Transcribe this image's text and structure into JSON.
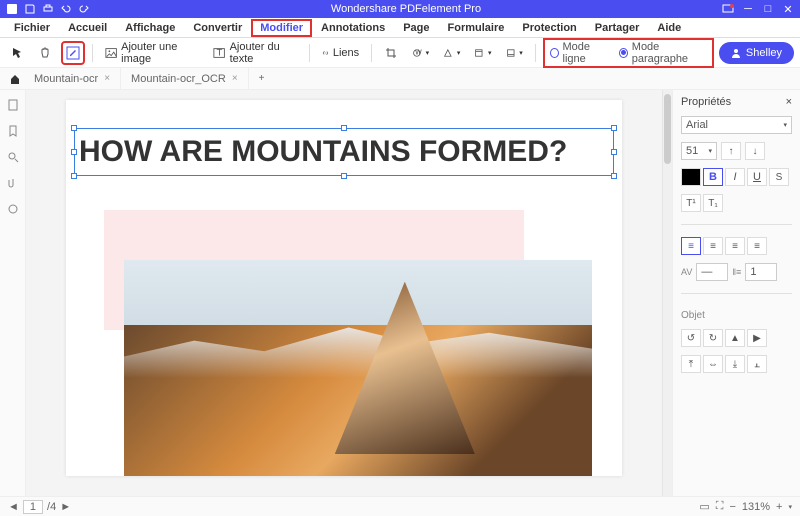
{
  "app": {
    "title": "Wondershare PDFelement Pro"
  },
  "menus": [
    "Fichier",
    "Accueil",
    "Affichage",
    "Convertir",
    "Modifier",
    "Annotations",
    "Page",
    "Formulaire",
    "Protection",
    "Partager",
    "Aide"
  ],
  "active_menu": "Modifier",
  "toolbar": {
    "add_image": "Ajouter une image",
    "add_text": "Ajouter du texte",
    "links": "Liens",
    "mode_line": "Mode ligne",
    "mode_paragraph": "Mode paragraphe",
    "mode_selected": "paragraph"
  },
  "user": {
    "name": "Shelley"
  },
  "tabs": [
    {
      "label": "Mountain-ocr"
    },
    {
      "label": "Mountain-ocr_OCR"
    }
  ],
  "document": {
    "headline": "HOW ARE MOUNTAINS FORMED?"
  },
  "properties": {
    "title": "Propriétés",
    "font": "Arial",
    "size": "51",
    "object_label": "Objet"
  },
  "status": {
    "page_current": "1",
    "page_total": "/4",
    "zoom": "131%"
  }
}
